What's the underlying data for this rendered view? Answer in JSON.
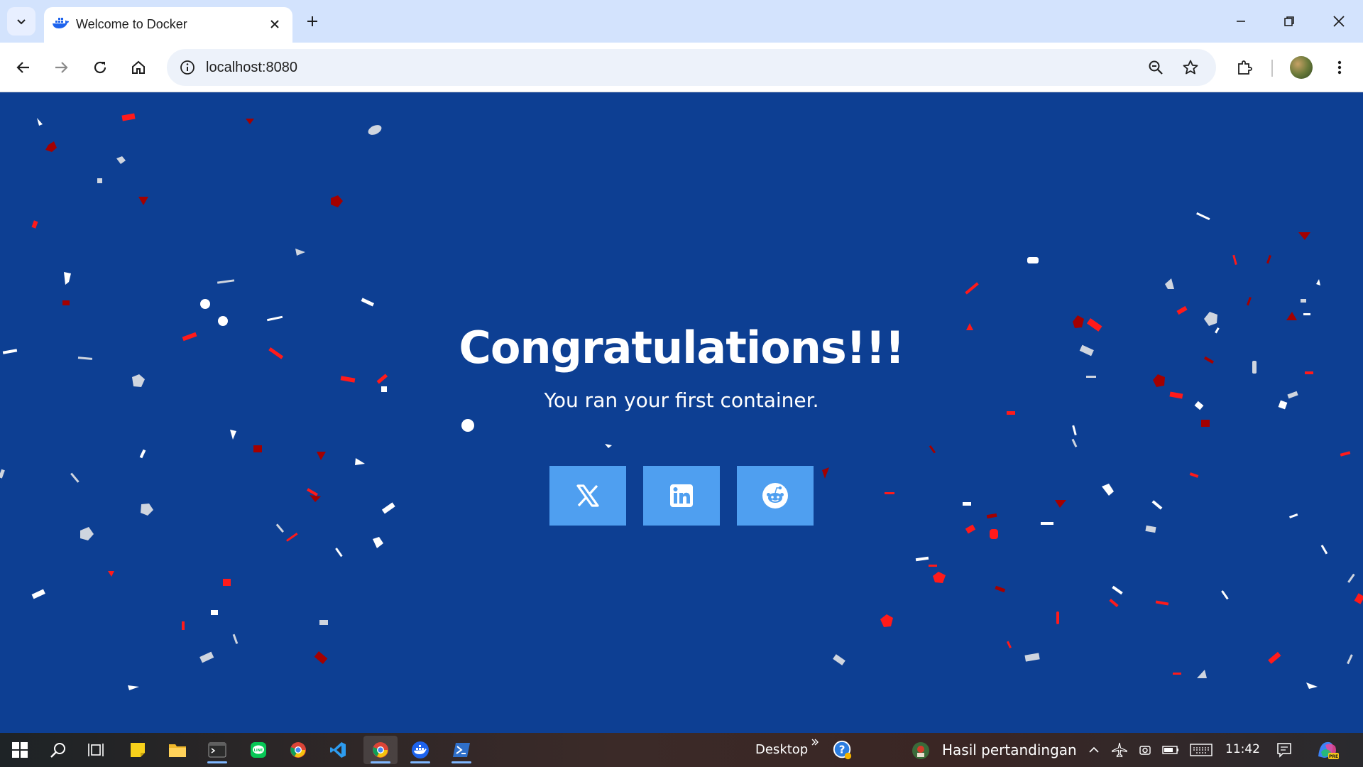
{
  "browser": {
    "tab": {
      "title": "Welcome to Docker"
    },
    "address": {
      "url": "localhost:8080"
    }
  },
  "page": {
    "headline": "Congratulations!!!",
    "subheadline": "You ran your first container.",
    "share_buttons": [
      "x-twitter",
      "linkedin",
      "reddit"
    ],
    "colors": {
      "background": "#0d3f93",
      "button": "#4f9ff0",
      "confetti": [
        "#ff1a1a",
        "#a30000",
        "#ffffff",
        "#cfd5df"
      ]
    }
  },
  "taskbar": {
    "desktop_label": "Desktop",
    "news_label": "Hasil pertandingan",
    "clock": "11:42"
  }
}
